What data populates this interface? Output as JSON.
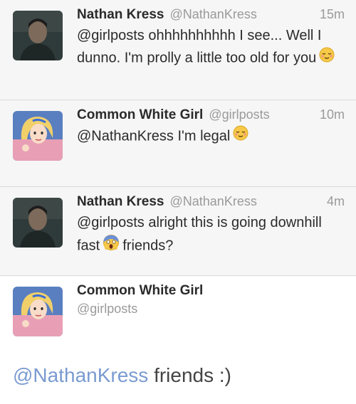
{
  "tweets": [
    {
      "name": "Nathan Kress",
      "handle": "@NathanKress",
      "time": "15m",
      "text_part1": "@girlposts ohhhhhhhhhh I see... Well I dunno. I'm prolly a little too old for you",
      "emoji": "relieved-face"
    },
    {
      "name": "Common White Girl",
      "handle": "@girlposts",
      "time": "10m",
      "text_part1": "@NathanKress I'm legal",
      "emoji": "relieved-face"
    },
    {
      "name": "Nathan Kress",
      "handle": "@NathanKress",
      "time": "4m",
      "text_part1": "@girlposts alright this is going downhill fast",
      "emoji": "scream-face",
      "text_part2": "friends?"
    }
  ],
  "original": {
    "name": "Common White Girl",
    "handle": "@girlposts",
    "reply_mention": "@NathanKress",
    "reply_text": " friends :)"
  },
  "colors": {
    "link": "#7a9bd0",
    "meta_gray": "#9a9a9a",
    "background": "#f6f6f6"
  }
}
